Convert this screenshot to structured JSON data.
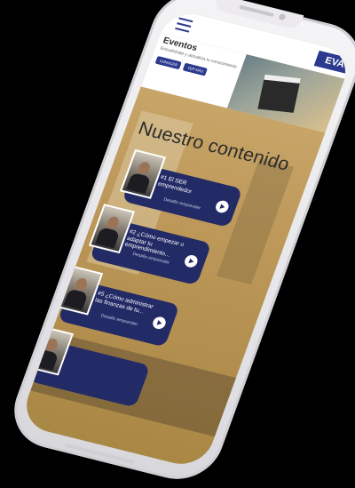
{
  "topbar": {
    "brand": "EVA"
  },
  "banner": {
    "title": "Eventos",
    "subtitle": "Encuéntrate y actualiza tu conocimiento",
    "button_primary": "CONOCER",
    "button_secondary": "VER MÁS"
  },
  "section": {
    "title": "Nuestro contenido"
  },
  "cards": [
    {
      "title": "#1 El SER emprendedor",
      "author": "Desafio emprender"
    },
    {
      "title": "#2 ¿Cómo empezar o adaptar tu emprendimiento...",
      "author": "Desafio emprender"
    },
    {
      "title": "#5 ¿Cómo administrar las finanzas de tu...",
      "author": "Desafio emprender"
    },
    {
      "title": "",
      "author": ""
    }
  ],
  "colors": {
    "primary": "#232b66",
    "accent": "#2b3a8e",
    "background": "#000000"
  },
  "icons": {
    "menu": "hamburger-icon",
    "play": "play-icon"
  }
}
